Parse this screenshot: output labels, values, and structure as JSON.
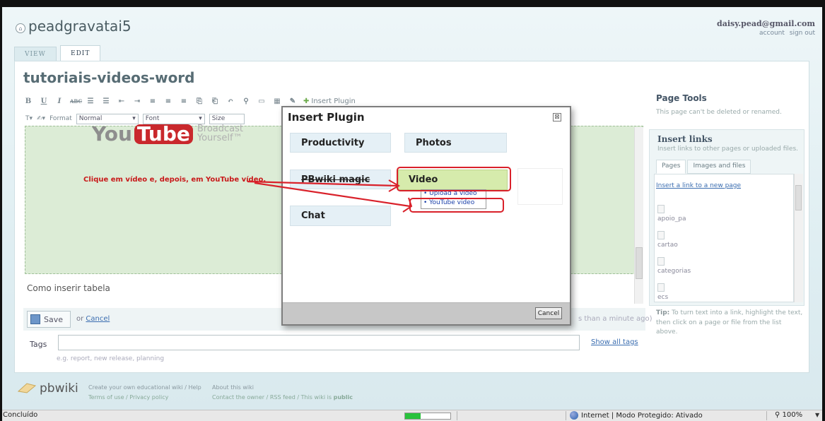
{
  "header": {
    "wiki_name": "peadgravatai5",
    "user_email": "daisy.pead@gmail.com",
    "account_link": "account",
    "signout_link": "sign out"
  },
  "tabs": [
    {
      "label": "VIEW",
      "active": false
    },
    {
      "label": "EDIT",
      "active": true
    }
  ],
  "page": {
    "title": "tutoriais-videos-word"
  },
  "toolbar": {
    "row1": [
      "B",
      "U",
      "I",
      "ABC"
    ],
    "insert_plugin": "Insert Plugin",
    "format_label": "Format",
    "format_value": "Normal",
    "font_value": "Font",
    "size_value": "Size"
  },
  "editor": {
    "youtube_logo": {
      "you": "You",
      "tube": "Tube",
      "tagline_1": "Broadcast",
      "tagline_2": "Yourself™"
    },
    "instruction": "Clique em vídeo e, depois, em YouTube vídeo.",
    "heading": "Como inserir tabela"
  },
  "save_row": {
    "save_label": "Save",
    "or_label": "or",
    "cancel_label": "Cancel",
    "edit_meta": "s than a minute ago)"
  },
  "tags": {
    "label": "Tags",
    "value": "",
    "placeholder": "e.g. report, new release, planning",
    "show_all": "Show all tags"
  },
  "sidebar": {
    "page_tools_title": "Page Tools",
    "page_tools_note": "This page can't be deleted or renamed.",
    "insert_links_title": "Insert links",
    "insert_links_sub": "Insert links to other pages or uploaded files.",
    "tabs": [
      "Pages",
      "Images and files"
    ],
    "new_page_link": "Insert a link to a new page",
    "pages": [
      "apoio_pa",
      "cartao",
      "categorias",
      "ecs"
    ],
    "tip_label": "Tip:",
    "tip_text": "To turn text into a link, highlight the text, then click on a page or file from the list above."
  },
  "dialog": {
    "title": "Insert Plugin",
    "close_glyph": "⊠",
    "plugins": [
      "Productivity",
      "Photos",
      "PBwiki magic",
      "Video",
      "Chat"
    ],
    "video_submenu": [
      "• Upload a video",
      "• YouTube video"
    ],
    "cancel_label": "Cancel"
  },
  "footer": {
    "brand": "pbwiki",
    "col1_line1": "Create your own educational wiki / Help",
    "col1_line2": "Terms of use / Privacy policy",
    "col2_line1": "About this wiki",
    "col2_line2_prefix": "Contact the owner / RSS feed / This wiki is ",
    "col2_line2_bold": "public"
  },
  "statusbar": {
    "status_text": "Concluído",
    "progress": 0.35,
    "zone_text": "Internet | Modo Protegido: Ativado",
    "zoom": "100%",
    "zoom_prefix_icon": "magnifier-icon"
  },
  "colors": {
    "annotation_red": "#d9212a",
    "video_tile": "#d6ebac",
    "plugin_tile": "#e5f0f6",
    "editor_bg": "#dcecd6",
    "link_blue": "#3a6db0"
  }
}
